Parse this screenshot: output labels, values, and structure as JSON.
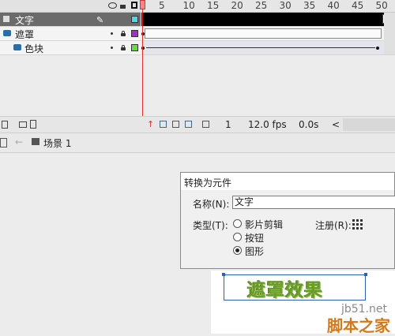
{
  "timeline": {
    "ruler_numbers": [
      "5",
      "10",
      "15",
      "20",
      "25",
      "30",
      "35",
      "40",
      "45",
      "50"
    ],
    "layers": [
      {
        "name": "文字",
        "selected": true,
        "swatch_color": "#4dd9d9"
      },
      {
        "name": "遮罩",
        "selected": false,
        "swatch_color": "#9933cc"
      },
      {
        "name": "色块",
        "selected": false,
        "swatch_color": "#66dd44"
      }
    ],
    "footer": {
      "frame": "1",
      "fps": "12.0 fps",
      "time": "0.0s"
    }
  },
  "scene": {
    "label": "场景 1"
  },
  "dialog": {
    "title": "转换为元件",
    "name_label": "名称(N):",
    "name_value": "文字",
    "type_label": "类型(T):",
    "type_options": [
      "影片剪辑",
      "按钮",
      "图形"
    ],
    "type_selected": "图形",
    "registration_label": "注册(R):"
  },
  "stage": {
    "symbol_text": "遮罩效果"
  },
  "watermark": {
    "site": "jb51.net",
    "brand": "脚本之家"
  },
  "colors": {
    "playhead": "#d9342b",
    "selection": "#2f5fb5",
    "symbol_text": "#6b9b2c",
    "brand": "#d4791b"
  }
}
